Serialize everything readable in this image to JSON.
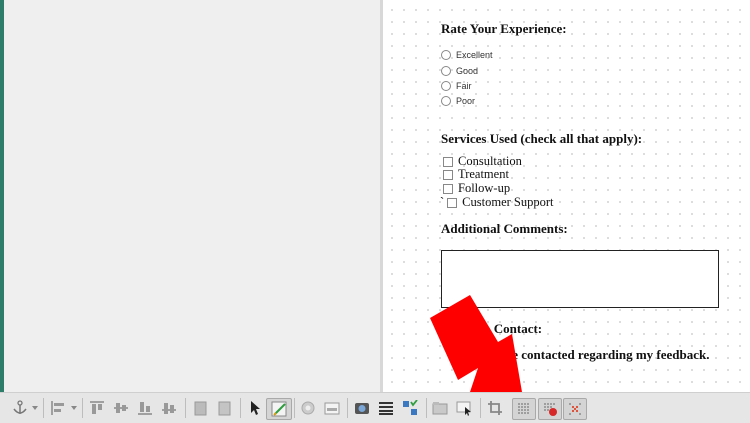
{
  "form": {
    "rate_heading": "Rate Your Experience:",
    "rating_options": [
      "Excellent",
      "Good",
      "Fair",
      "Poor"
    ],
    "services_heading": "Services Used (check all that apply):",
    "services": [
      "Consultation",
      "Treatment",
      "Follow-up",
      "Customer Support"
    ],
    "stray_char": "`",
    "comments_heading": "Additional Comments:",
    "contact_heading_visible_start": "Co",
    "contact_heading_visible_end": "o Contact:",
    "contact_option_visible": "be contacted regarding my feedback."
  },
  "annotation": {
    "arrow_color": "#ff0000"
  },
  "toolbar": {
    "icons": [
      "anchor-icon",
      "align-icon",
      "align-top-icon",
      "align-center-icon",
      "align-bottom-icon",
      "align-baseline-icon",
      "bring-front-icon",
      "send-back-icon",
      "select-pointer-icon",
      "edit-form-icon",
      "form-control-wizard-icon",
      "form-design-icon",
      "image-control-icon",
      "tab-order-icon",
      "form-navigator-icon",
      "open-form-icon",
      "focus-icon",
      "toggle-grid-icon",
      "snap-to-grid-icon",
      "helplines-icon",
      "grid-3-icon"
    ]
  },
  "colors": {
    "accent_green": "#2e7d6b",
    "toolbar_bg": "#e6e6e6"
  }
}
